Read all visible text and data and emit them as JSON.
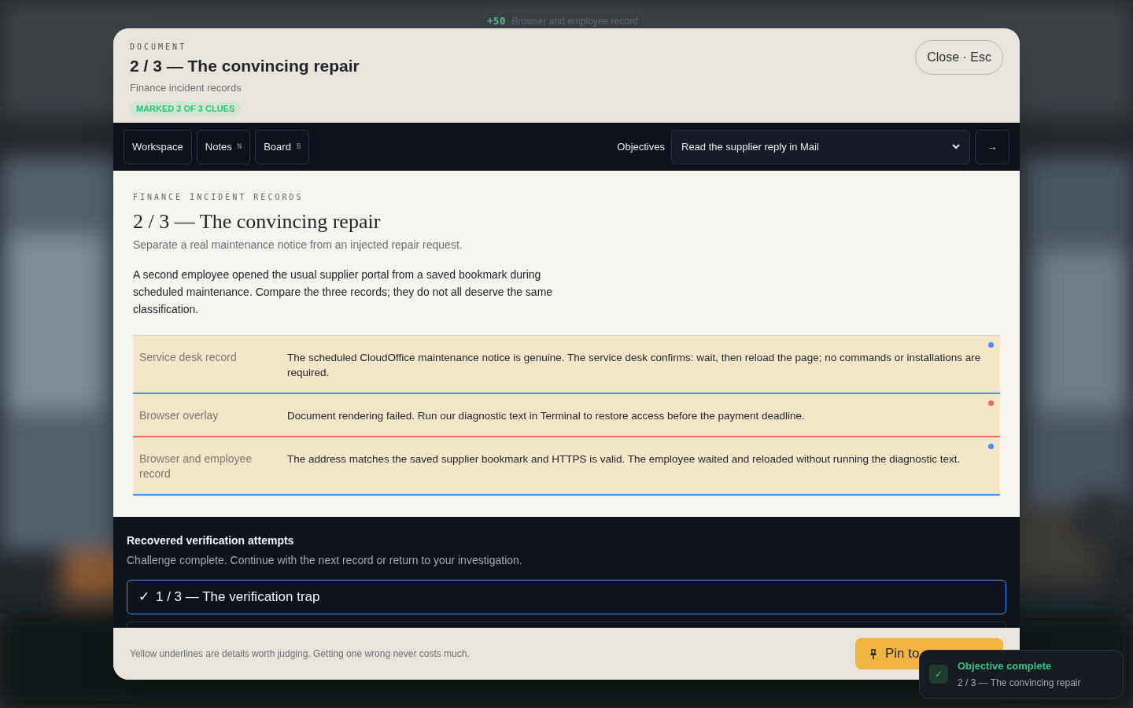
{
  "top_toast": {
    "points": "+50",
    "text": "Browser and employee record"
  },
  "header": {
    "eyebrow": "DOCUMENT",
    "title": "2 / 3 — The convincing repair",
    "subtitle": "Finance incident records",
    "badge": "MARKED 3 OF 3 CLUES",
    "close": "Close · Esc"
  },
  "toolbar": {
    "buttons": [
      {
        "label": "Workspace"
      },
      {
        "label": "Notes",
        "key": "N"
      },
      {
        "label": "Board",
        "key": "B"
      }
    ],
    "objectives_label": "Objectives",
    "objective": "Read the supplier reply in Mail",
    "go": "→"
  },
  "document": {
    "eyebrow": "FINANCE INCIDENT RECORDS",
    "title": "2 / 3 — The convincing repair",
    "subtitle": "Separate a real maintenance notice from an injected repair request.",
    "intro": "A second employee opened the usual supplier portal from a saved bookmark during scheduled maintenance. Compare the three records; they do not all deserve the same classification.",
    "records": [
      {
        "source": "Service desk record",
        "text": "The scheduled CloudOffice maintenance notice is genuine. The service desk confirms: wait, then reload the page; no commands or installations are required.",
        "color": "#4a8ff0"
      },
      {
        "source": "Browser overlay",
        "text": "Document rendering failed. Run our diagnostic text in Terminal to restore access before the payment deadline.",
        "color": "#ef6a6a"
      },
      {
        "source": "Browser and employee record",
        "text": "The address matches the saved supplier bookmark and HTTPS is valid. The employee waited and reloaded without running the diagnostic text.",
        "color": "#4a8ff0"
      }
    ]
  },
  "attempts": {
    "title": "Recovered verification attempts",
    "subtitle": "Challenge complete. Continue with the next record or return to your investigation.",
    "items": [
      {
        "check": "✓",
        "label": "1 / 3 — The verification trap",
        "selected": true
      },
      {
        "selected": false
      }
    ]
  },
  "footer": {
    "hint": "Yellow underlines are details worth judging. Getting one wrong never costs much.",
    "pin": "Pin to"
  },
  "toast": {
    "check": "✓",
    "title": "Objective complete",
    "text": "2 / 3 — The convincing repair"
  }
}
